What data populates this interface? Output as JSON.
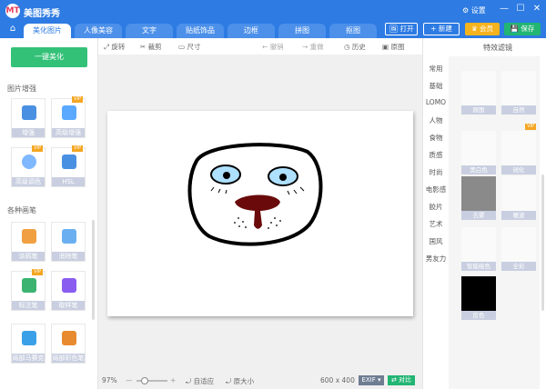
{
  "app": {
    "logo": "MT",
    "title": "美图秀秀",
    "settings": "⚙ 设置",
    "min": "—",
    "max": "☐",
    "close": "✕"
  },
  "tabs": [
    "美化图片",
    "人像美容",
    "文字",
    "贴纸饰品",
    "边框",
    "拼图",
    "抠图"
  ],
  "top_buttons": {
    "open": "🖼 打开",
    "new": "+ 新建",
    "vip": "♛ 会员",
    "save": "💾 保存"
  },
  "left": {
    "onekey": "一键美化",
    "section1": "图片增强",
    "section2": "各种画笔",
    "tools": [
      {
        "label": "增强",
        "vip": false
      },
      {
        "label": "高级增强",
        "vip": true
      },
      {
        "label": "高级调色",
        "vip": true
      },
      {
        "label": "HSL",
        "vip": true
      },
      {
        "label": "涂鸦笔",
        "vip": false
      },
      {
        "label": "消除笔",
        "vip": false
      },
      {
        "label": "标注笔",
        "vip": true
      },
      {
        "label": "取样笔",
        "vip": false
      },
      {
        "label": "局部马赛克",
        "vip": false
      },
      {
        "label": "局部彩色笔",
        "vip": false
      }
    ],
    "vip_badge": "VIP"
  },
  "toolbar": {
    "rotate": "⤢ 旋转",
    "crop": "✂ 裁剪",
    "size": "▭ 尺寸",
    "undo": "← 撤销",
    "redo": "→ 重做",
    "history": "◷ 历史",
    "original": "▣ 原图"
  },
  "bottom": {
    "zoom": "97%",
    "fit": "⤾ 自适应",
    "actual": "⤾ 原大小",
    "dims": "600 x 400",
    "exif": "EXIF ▾",
    "compare": "⇄ 对比"
  },
  "right": {
    "header": "特效滤镜",
    "categories": [
      "常用",
      "基础",
      "LOMO",
      "人物",
      "食物",
      "质感",
      "时尚",
      "电影感",
      "胶片",
      "艺术",
      "国风",
      "男友力"
    ],
    "filters": [
      {
        "label": "原图",
        "vip": false
      },
      {
        "label": "自然",
        "vip": false
      },
      {
        "label": "黑白色",
        "vip": false
      },
      {
        "label": "锐化",
        "vip": true
      },
      {
        "label": "去雾",
        "vip": false
      },
      {
        "label": "暖波",
        "vip": false
      },
      {
        "label": "智能绘色",
        "vip": false
      },
      {
        "label": "全彩",
        "vip": false
      },
      {
        "label": "反色",
        "vip": false
      }
    ],
    "vip_badge": "VIP"
  }
}
